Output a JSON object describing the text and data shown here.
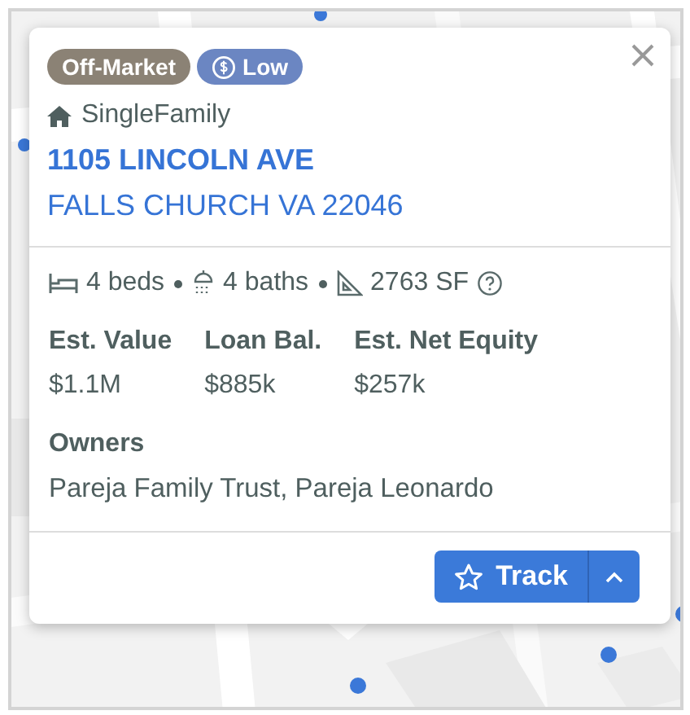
{
  "popup": {
    "badges": [
      {
        "kind": "status",
        "label": "Off-Market",
        "color": "#8b8275"
      },
      {
        "kind": "equity",
        "label": "Low",
        "color": "#6b86c2"
      }
    ],
    "property_type": "SingleFamily",
    "address": "1105 LINCOLN AVE",
    "city_line": "FALLS CHURCH VA 22046",
    "facts": [
      {
        "kind": "beds",
        "text": "4 beds",
        "help": false
      },
      {
        "kind": "baths",
        "text": "4 baths",
        "help": false
      },
      {
        "kind": "area",
        "text": "2763 SF",
        "help": true
      }
    ],
    "metrics": [
      {
        "label": "Est. Value",
        "value": "$1.1M"
      },
      {
        "label": "Loan Bal.",
        "value": "$885k"
      },
      {
        "label": "Est. Net Equity",
        "value": "$257k"
      }
    ],
    "owners": {
      "label": "Owners",
      "value": "Pareja Family Trust, Pareja Leonardo"
    },
    "track_button": {
      "label": "Track"
    }
  }
}
